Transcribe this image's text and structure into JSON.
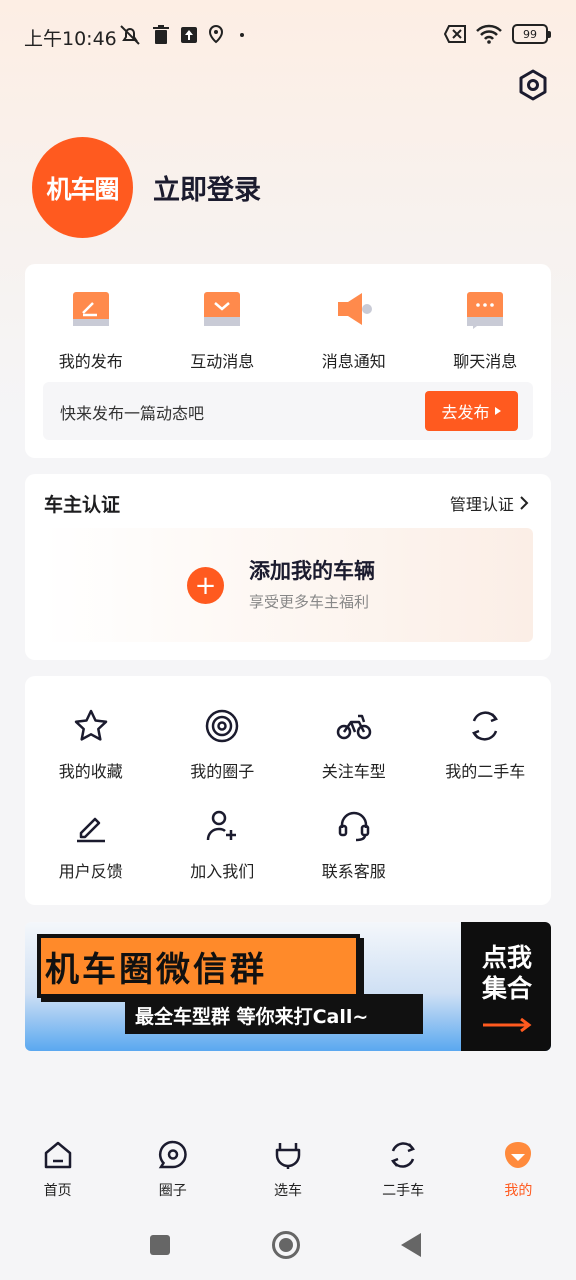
{
  "status_bar": {
    "time": "上午10:46",
    "battery": "99",
    "icons": [
      "mute-icon",
      "trash-icon",
      "upload-icon",
      "location-icon",
      "dot-icon",
      "sim-off-icon",
      "wifi-icon"
    ]
  },
  "profile": {
    "logo_text": "机车圈",
    "login_label": "立即登录"
  },
  "quick_actions": [
    {
      "label": "我的发布",
      "icon": "edit-doc-icon"
    },
    {
      "label": "互动消息",
      "icon": "message-box-icon"
    },
    {
      "label": "消息通知",
      "icon": "megaphone-icon"
    },
    {
      "label": "聊天消息",
      "icon": "chat-bubble-icon"
    }
  ],
  "publish": {
    "prompt": "快来发布一篇动态吧",
    "button_label": "去发布"
  },
  "owner_cert": {
    "title": "车主认证",
    "manage_label": "管理认证",
    "add_title": "添加我的车辆",
    "add_subtitle": "享受更多车主福利"
  },
  "services": [
    {
      "label": "我的收藏",
      "icon": "star-icon"
    },
    {
      "label": "我的圈子",
      "icon": "circle-target-icon"
    },
    {
      "label": "关注车型",
      "icon": "motorcycle-icon"
    },
    {
      "label": "我的二手车",
      "icon": "cycle-arrows-icon"
    },
    {
      "label": "用户反馈",
      "icon": "pencil-icon"
    },
    {
      "label": "加入我们",
      "icon": "add-user-icon"
    },
    {
      "label": "联系客服",
      "icon": "headset-icon"
    }
  ],
  "banner": {
    "title": "机车圈微信群",
    "subtitle": "最全车型群 等你来打Call~",
    "cta_line1": "点我",
    "cta_line2": "集合"
  },
  "tabs": [
    {
      "label": "首页",
      "icon": "home-icon"
    },
    {
      "label": "圈子",
      "icon": "circle-icon"
    },
    {
      "label": "选车",
      "icon": "plug-icon"
    },
    {
      "label": "二手车",
      "icon": "cycle-icon"
    },
    {
      "label": "我的",
      "icon": "profile-icon",
      "active": true
    }
  ],
  "colors": {
    "accent": "#ff5a1f",
    "text": "#1b1b2e",
    "background": "#f5f5f7"
  }
}
